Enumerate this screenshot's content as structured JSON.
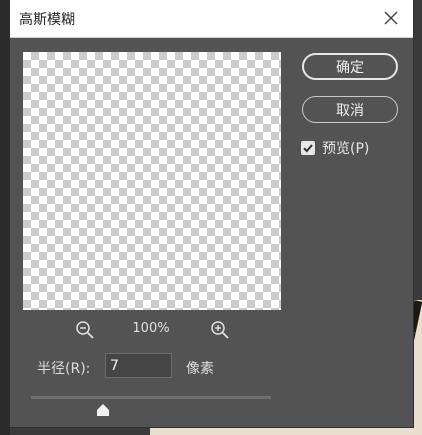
{
  "dialog": {
    "title": "高斯模糊",
    "close_icon": "close-icon"
  },
  "preview": {
    "zoom_level": "100%",
    "zoom_out_icon": "zoom-out-icon",
    "zoom_in_icon": "zoom-in-icon"
  },
  "radius": {
    "label": "半径(R):",
    "value": "7",
    "unit": "像素",
    "slider_fraction": 0.3
  },
  "buttons": {
    "ok_label": "确定",
    "cancel_label": "取消"
  },
  "preview_toggle": {
    "label": "预览(P)",
    "checked": true
  }
}
